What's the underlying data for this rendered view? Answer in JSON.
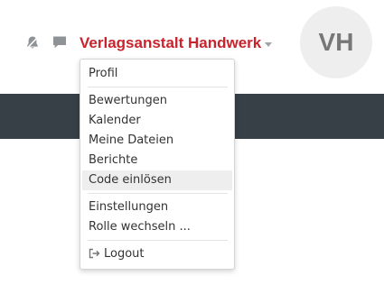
{
  "header": {
    "user_name": "Verlagsanstalt Handwerk",
    "avatar_initials": "VH",
    "icons": [
      "bell-icon",
      "message-icon",
      "caret-down-icon"
    ]
  },
  "menu": {
    "items": [
      {
        "label": "Profil"
      },
      {
        "label": "Bewertungen"
      },
      {
        "label": "Kalender"
      },
      {
        "label": "Meine Dateien"
      },
      {
        "label": "Berichte"
      },
      {
        "label": "Code einlösen",
        "highlighted": true
      },
      {
        "label": "Einstellungen"
      },
      {
        "label": "Rolle wechseln ..."
      },
      {
        "label": "Logout",
        "icon": "logout-icon"
      }
    ]
  },
  "colors": {
    "accent": "#c9232d",
    "navbar": "#373f47",
    "avatar_bg": "#eeeeee",
    "highlight": "#eeeeee"
  }
}
